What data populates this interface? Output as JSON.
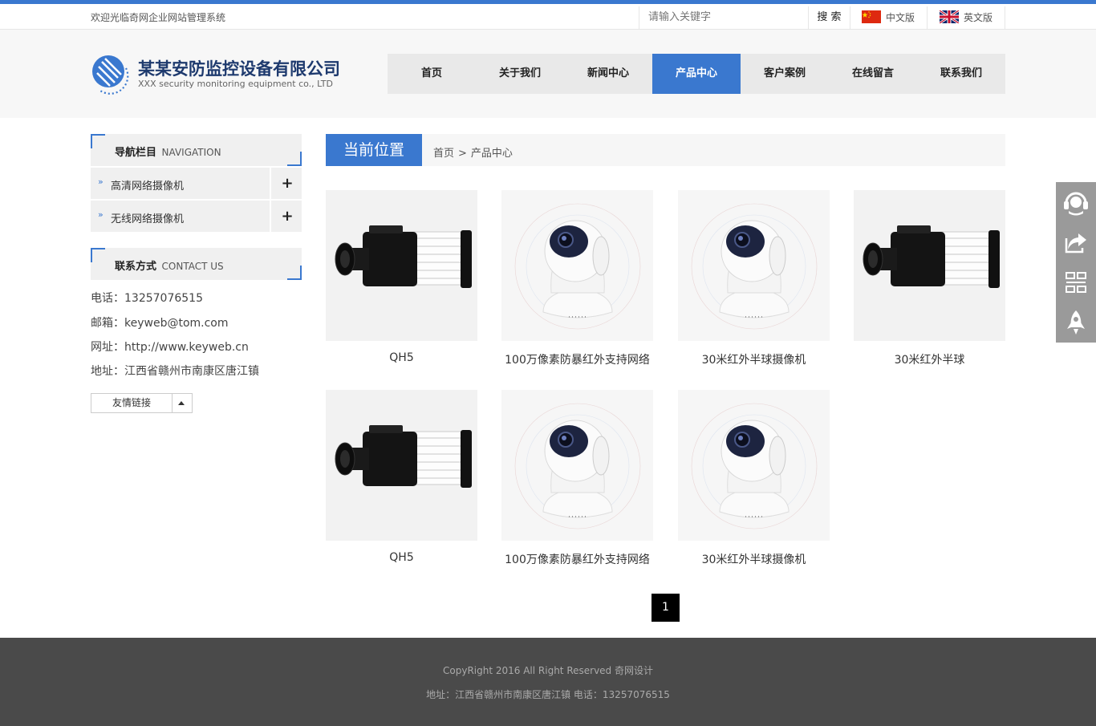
{
  "colors": {
    "accent": "#3a78cf",
    "footer_bg": "#4a4a4a",
    "header_bg": "#f7f7f7"
  },
  "topbar": {
    "welcome": "欢迎光临奇网企业网站管理系统",
    "search_placeholder": "请输入关键字",
    "search_label": "搜 索",
    "lang_cn": "中文版",
    "lang_en": "英文版"
  },
  "logo": {
    "name_cn": "某某安防监控设备有限公司",
    "name_en": "XXX security monitoring equipment co., LTD"
  },
  "nav": {
    "items": [
      {
        "label": "首页"
      },
      {
        "label": "关于我们"
      },
      {
        "label": "新闻中心"
      },
      {
        "label": "产品中心"
      },
      {
        "label": "客户案例"
      },
      {
        "label": "在线留言"
      },
      {
        "label": "联系我们"
      }
    ],
    "active": "产品中心"
  },
  "sidebar": {
    "nav_title": "导航栏目",
    "nav_title_en": "NAVIGATION",
    "categories": [
      {
        "label": "高清网络摄像机"
      },
      {
        "label": "无线网络摄像机"
      }
    ],
    "contact_title": "联系方式",
    "contact_title_en": "CONTACT US",
    "contact": [
      "电话：13257076515",
      "邮箱：keyweb@tom.com",
      "网址：http://www.keyweb.cn",
      "地址：江西省赣州市南康区唐江镇"
    ],
    "friend_links": "友情链接"
  },
  "breadcrumb": {
    "title": "当前位置",
    "home": "首页",
    "separator": ">",
    "current": "产品中心"
  },
  "products": [
    {
      "name": "QH5",
      "icon": "box-camera-icon"
    },
    {
      "name": "100万像素防暴红外支持网络",
      "icon": "dome-camera-icon"
    },
    {
      "name": "30米红外半球摄像机",
      "icon": "dome-camera-icon"
    },
    {
      "name": "30米红外半球",
      "icon": "box-camera-icon"
    },
    {
      "name": "QH5",
      "icon": "box-camera-icon"
    },
    {
      "name": "100万像素防暴红外支持网络",
      "icon": "dome-camera-icon"
    },
    {
      "name": "30米红外半球摄像机",
      "icon": "dome-camera-icon"
    }
  ],
  "pagination": {
    "current": "1"
  },
  "footer": {
    "copyright": "CopyRight 2016 All Right Reserved 奇网设计",
    "address": "地址：江西省赣州市南康区唐江镇  电话：13257076515"
  },
  "float_bar": [
    "headset-icon",
    "share-icon",
    "qrcode-icon",
    "rocket-icon"
  ]
}
